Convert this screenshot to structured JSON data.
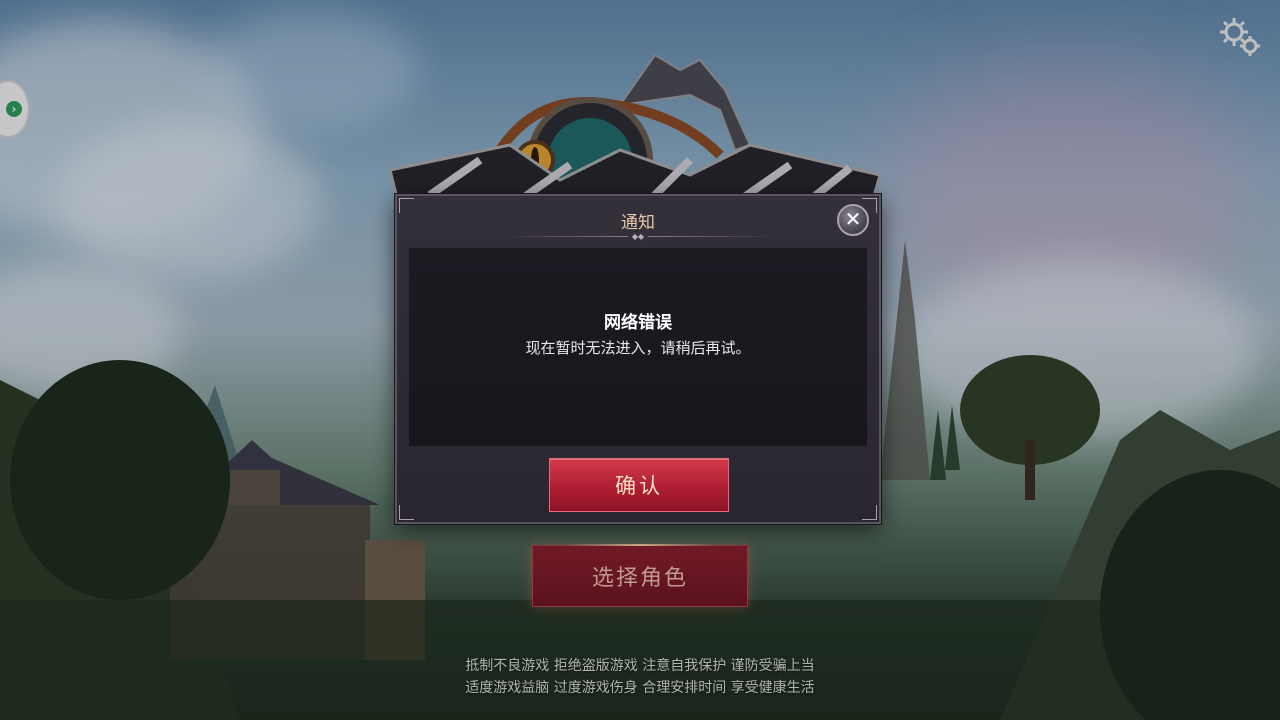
{
  "dialog": {
    "title": "通知",
    "message_title": "网络错误",
    "message_body": "现在暂时无法进入，请稍后再试。",
    "confirm_label": "确认",
    "close_glyph": "✕"
  },
  "main": {
    "select_role_label": "选择角色"
  },
  "footer": {
    "line1": "抵制不良游戏 拒绝盗版游戏 注意自我保护 谨防受骗上当",
    "line2": "适度游戏益脑 过度游戏伤身 合理安排时间 享受健康生活"
  },
  "icons": {
    "settings": "gear-icon",
    "side_toggle": "chevron-right-icon",
    "close": "close-icon"
  },
  "colors": {
    "confirm_button": "#b01e33",
    "dialog_title": "#e6c8a6",
    "select_role_button": "#7a1826"
  }
}
